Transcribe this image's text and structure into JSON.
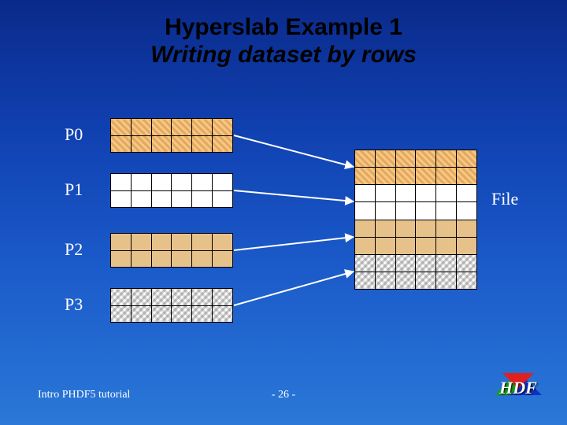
{
  "title": {
    "line1": "Hyperslab Example 1",
    "line2": "Writing dataset by rows"
  },
  "processes": [
    "P0",
    "P1",
    "P2",
    "P3"
  ],
  "file_label": "File",
  "footer": {
    "left": "Intro PHDF5 tutorial",
    "center": "- 26 -",
    "logo_text": "HDF"
  },
  "diagram": {
    "proc_block": {
      "rows": 2,
      "cols": 6
    },
    "file_block": {
      "rows": 8,
      "cols": 6
    },
    "proc_fill": [
      "diag",
      "empty",
      "tan",
      "wave"
    ],
    "file_row_fill": [
      "diag",
      "diag",
      "empty",
      "empty",
      "tan",
      "tan",
      "wave",
      "wave"
    ],
    "arrows": [
      {
        "from": "P0",
        "to_file_row": 1
      },
      {
        "from": "P1",
        "to_file_row": 3
      },
      {
        "from": "P2",
        "to_file_row": 5
      },
      {
        "from": "P3",
        "to_file_row": 7
      }
    ]
  }
}
